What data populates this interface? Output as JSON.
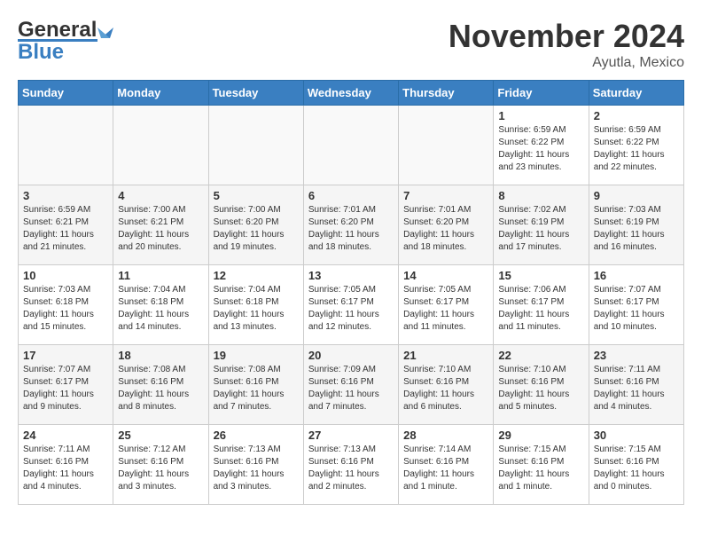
{
  "logo": {
    "general": "General",
    "blue": "Blue"
  },
  "title": "November 2024",
  "location": "Ayutla, Mexico",
  "days_of_week": [
    "Sunday",
    "Monday",
    "Tuesday",
    "Wednesday",
    "Thursday",
    "Friday",
    "Saturday"
  ],
  "weeks": [
    [
      {
        "day": "",
        "info": ""
      },
      {
        "day": "",
        "info": ""
      },
      {
        "day": "",
        "info": ""
      },
      {
        "day": "",
        "info": ""
      },
      {
        "day": "",
        "info": ""
      },
      {
        "day": "1",
        "info": "Sunrise: 6:59 AM\nSunset: 6:22 PM\nDaylight: 11 hours and 23 minutes."
      },
      {
        "day": "2",
        "info": "Sunrise: 6:59 AM\nSunset: 6:22 PM\nDaylight: 11 hours and 22 minutes."
      }
    ],
    [
      {
        "day": "3",
        "info": "Sunrise: 6:59 AM\nSunset: 6:21 PM\nDaylight: 11 hours and 21 minutes."
      },
      {
        "day": "4",
        "info": "Sunrise: 7:00 AM\nSunset: 6:21 PM\nDaylight: 11 hours and 20 minutes."
      },
      {
        "day": "5",
        "info": "Sunrise: 7:00 AM\nSunset: 6:20 PM\nDaylight: 11 hours and 19 minutes."
      },
      {
        "day": "6",
        "info": "Sunrise: 7:01 AM\nSunset: 6:20 PM\nDaylight: 11 hours and 18 minutes."
      },
      {
        "day": "7",
        "info": "Sunrise: 7:01 AM\nSunset: 6:20 PM\nDaylight: 11 hours and 18 minutes."
      },
      {
        "day": "8",
        "info": "Sunrise: 7:02 AM\nSunset: 6:19 PM\nDaylight: 11 hours and 17 minutes."
      },
      {
        "day": "9",
        "info": "Sunrise: 7:03 AM\nSunset: 6:19 PM\nDaylight: 11 hours and 16 minutes."
      }
    ],
    [
      {
        "day": "10",
        "info": "Sunrise: 7:03 AM\nSunset: 6:18 PM\nDaylight: 11 hours and 15 minutes."
      },
      {
        "day": "11",
        "info": "Sunrise: 7:04 AM\nSunset: 6:18 PM\nDaylight: 11 hours and 14 minutes."
      },
      {
        "day": "12",
        "info": "Sunrise: 7:04 AM\nSunset: 6:18 PM\nDaylight: 11 hours and 13 minutes."
      },
      {
        "day": "13",
        "info": "Sunrise: 7:05 AM\nSunset: 6:17 PM\nDaylight: 11 hours and 12 minutes."
      },
      {
        "day": "14",
        "info": "Sunrise: 7:05 AM\nSunset: 6:17 PM\nDaylight: 11 hours and 11 minutes."
      },
      {
        "day": "15",
        "info": "Sunrise: 7:06 AM\nSunset: 6:17 PM\nDaylight: 11 hours and 11 minutes."
      },
      {
        "day": "16",
        "info": "Sunrise: 7:07 AM\nSunset: 6:17 PM\nDaylight: 11 hours and 10 minutes."
      }
    ],
    [
      {
        "day": "17",
        "info": "Sunrise: 7:07 AM\nSunset: 6:17 PM\nDaylight: 11 hours and 9 minutes."
      },
      {
        "day": "18",
        "info": "Sunrise: 7:08 AM\nSunset: 6:16 PM\nDaylight: 11 hours and 8 minutes."
      },
      {
        "day": "19",
        "info": "Sunrise: 7:08 AM\nSunset: 6:16 PM\nDaylight: 11 hours and 7 minutes."
      },
      {
        "day": "20",
        "info": "Sunrise: 7:09 AM\nSunset: 6:16 PM\nDaylight: 11 hours and 7 minutes."
      },
      {
        "day": "21",
        "info": "Sunrise: 7:10 AM\nSunset: 6:16 PM\nDaylight: 11 hours and 6 minutes."
      },
      {
        "day": "22",
        "info": "Sunrise: 7:10 AM\nSunset: 6:16 PM\nDaylight: 11 hours and 5 minutes."
      },
      {
        "day": "23",
        "info": "Sunrise: 7:11 AM\nSunset: 6:16 PM\nDaylight: 11 hours and 4 minutes."
      }
    ],
    [
      {
        "day": "24",
        "info": "Sunrise: 7:11 AM\nSunset: 6:16 PM\nDaylight: 11 hours and 4 minutes."
      },
      {
        "day": "25",
        "info": "Sunrise: 7:12 AM\nSunset: 6:16 PM\nDaylight: 11 hours and 3 minutes."
      },
      {
        "day": "26",
        "info": "Sunrise: 7:13 AM\nSunset: 6:16 PM\nDaylight: 11 hours and 3 minutes."
      },
      {
        "day": "27",
        "info": "Sunrise: 7:13 AM\nSunset: 6:16 PM\nDaylight: 11 hours and 2 minutes."
      },
      {
        "day": "28",
        "info": "Sunrise: 7:14 AM\nSunset: 6:16 PM\nDaylight: 11 hours and 1 minute."
      },
      {
        "day": "29",
        "info": "Sunrise: 7:15 AM\nSunset: 6:16 PM\nDaylight: 11 hours and 1 minute."
      },
      {
        "day": "30",
        "info": "Sunrise: 7:15 AM\nSunset: 6:16 PM\nDaylight: 11 hours and 0 minutes."
      }
    ]
  ]
}
